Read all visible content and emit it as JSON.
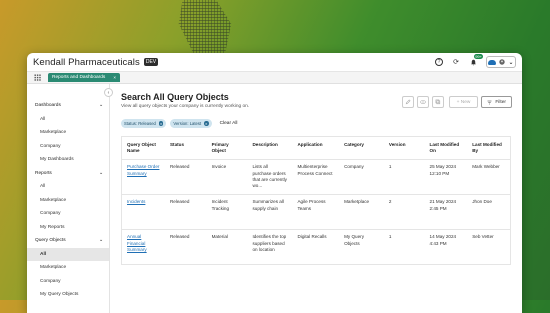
{
  "app": {
    "title": "Kendall Pharmaceuticals",
    "env_badge": "DEV",
    "notif_count": "99+"
  },
  "tabs": [
    {
      "label": "Reports and Dashboards",
      "close": "×"
    }
  ],
  "icons": {
    "help": "?",
    "sync": "⟳",
    "bell": "🔔",
    "user_chevron": "⌄",
    "collapse": "‹",
    "chevron": "⌄"
  },
  "sidebar": {
    "sections": [
      {
        "title": "Dashboards",
        "items": [
          "All",
          "Marketplace",
          "Company",
          "My Dashboards"
        ]
      },
      {
        "title": "Reports",
        "items": [
          "All",
          "Marketplace",
          "Company",
          "My Reports"
        ]
      },
      {
        "title": "Query Objects",
        "items": [
          "All",
          "Marketplace",
          "Company",
          "My Query Objects"
        ],
        "active": 0
      }
    ]
  },
  "main": {
    "title": "Search All Query Objects",
    "subtitle": "View all query objects your company is currently working on.",
    "new_label": "+ New",
    "filter_label": "Filter",
    "chips": [
      {
        "label": "Status: Released"
      },
      {
        "label": "Version: Latest"
      }
    ],
    "clear_all": "Clear All",
    "columns": [
      "Query Object Name",
      "Status",
      "Primary Object",
      "Description",
      "Application",
      "Category",
      "Version",
      "Last Modified On",
      "Last Modified By"
    ],
    "rows": [
      {
        "name": "Purchase Order Summary",
        "status": "Released",
        "primary": "Invoice",
        "description": "Lists all purchase orders that are currently wo...",
        "application": "Multienterprise Process Connect",
        "category": "Company",
        "version": "1",
        "modified_on": "25 May 2024 12:10 PM",
        "modified_by": "Mark Webber"
      },
      {
        "name": "Incidents",
        "status": "Released",
        "primary": "Incident Tracking",
        "description": "Summarizes all supply chain",
        "application": "Agile Process Teams",
        "category": "Marketplace",
        "version": "2",
        "modified_on": "21 May 2024 2:45 PM",
        "modified_by": "Jhon Doe"
      },
      {
        "name": "Annual Financial Summary",
        "status": "Released",
        "primary": "Material",
        "description": "Identifies the top suppliers based on location",
        "application": "Digital Recalls",
        "category": "My Query Objects",
        "version": "1",
        "modified_on": "14 May 2024 4:43 PM",
        "modified_by": "Seb Vetter"
      }
    ]
  }
}
